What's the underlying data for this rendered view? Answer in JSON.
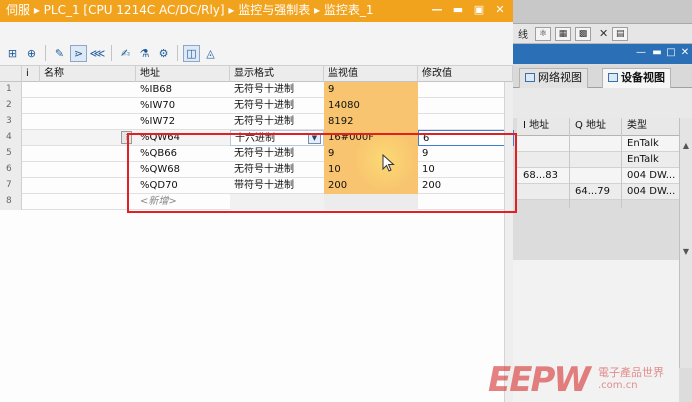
{
  "window": {
    "title": "伺服 ▸ PLC_1 [CPU 1214C AC/DC/Rly] ▸ 监控与强制表 ▸ 监控表_1",
    "controls": [
      "minimize-icon",
      "restore-icon",
      "maximize-icon",
      "close-icon"
    ]
  },
  "toolbar": {
    "icons": [
      "insert-row-icon",
      "add-row-icon",
      "modify-icon",
      "monitor-all-icon",
      "monitor-once-icon",
      "modify-now-icon",
      "modify-trigger-icon",
      "force-icon",
      "show-extended-icon",
      "show-all-columns-icon"
    ]
  },
  "table": {
    "columns": {
      "info": "i",
      "name": "名称",
      "address": "地址",
      "format": "显示格式",
      "monitor": "监视值",
      "modify": "修改值"
    },
    "rows": [
      {
        "num": "1",
        "name": "",
        "address": "%IB68",
        "format": "无符号十进制",
        "monitor": "9",
        "modify": ""
      },
      {
        "num": "2",
        "name": "",
        "address": "%IW70",
        "format": "无符号十进制",
        "monitor": "14080",
        "modify": ""
      },
      {
        "num": "3",
        "name": "",
        "address": "%IW72",
        "format": "无符号十进制",
        "monitor": "8192",
        "modify": ""
      },
      {
        "num": "4",
        "name": "",
        "address": "%QW64",
        "format": "十六进制",
        "monitor": "16#000F",
        "modify": "6"
      },
      {
        "num": "5",
        "name": "",
        "address": "%QB66",
        "format": "无符号十进制",
        "monitor": "9",
        "modify": "9"
      },
      {
        "num": "6",
        "name": "",
        "address": "%QW68",
        "format": "无符号十进制",
        "monitor": "10",
        "modify": "10"
      },
      {
        "num": "7",
        "name": "",
        "address": "%QD70",
        "format": "带符号十进制",
        "monitor": "200",
        "modify": "200"
      },
      {
        "num": "8",
        "name": "",
        "address": "<新增>",
        "format": "",
        "monitor": "",
        "modify": ""
      }
    ]
  },
  "background": {
    "toolbar_text": "线",
    "tabs": [
      "网络视图",
      "设备视图"
    ],
    "grid_headers": [
      "I 地址",
      "Q 地址",
      "类型"
    ],
    "grid_rows": [
      {
        "i": "",
        "q": "",
        "type": "EnTalk"
      },
      {
        "i": "",
        "q": "",
        "type": "EnTalk"
      },
      {
        "i": "68...83",
        "q": "",
        "type": "004 DW..."
      },
      {
        "i": "",
        "q": "64...79",
        "type": "004 DW..."
      }
    ]
  },
  "watermark": {
    "logo": "EEPW",
    "cn": "電子產品世界",
    "url": ".com.cn"
  }
}
